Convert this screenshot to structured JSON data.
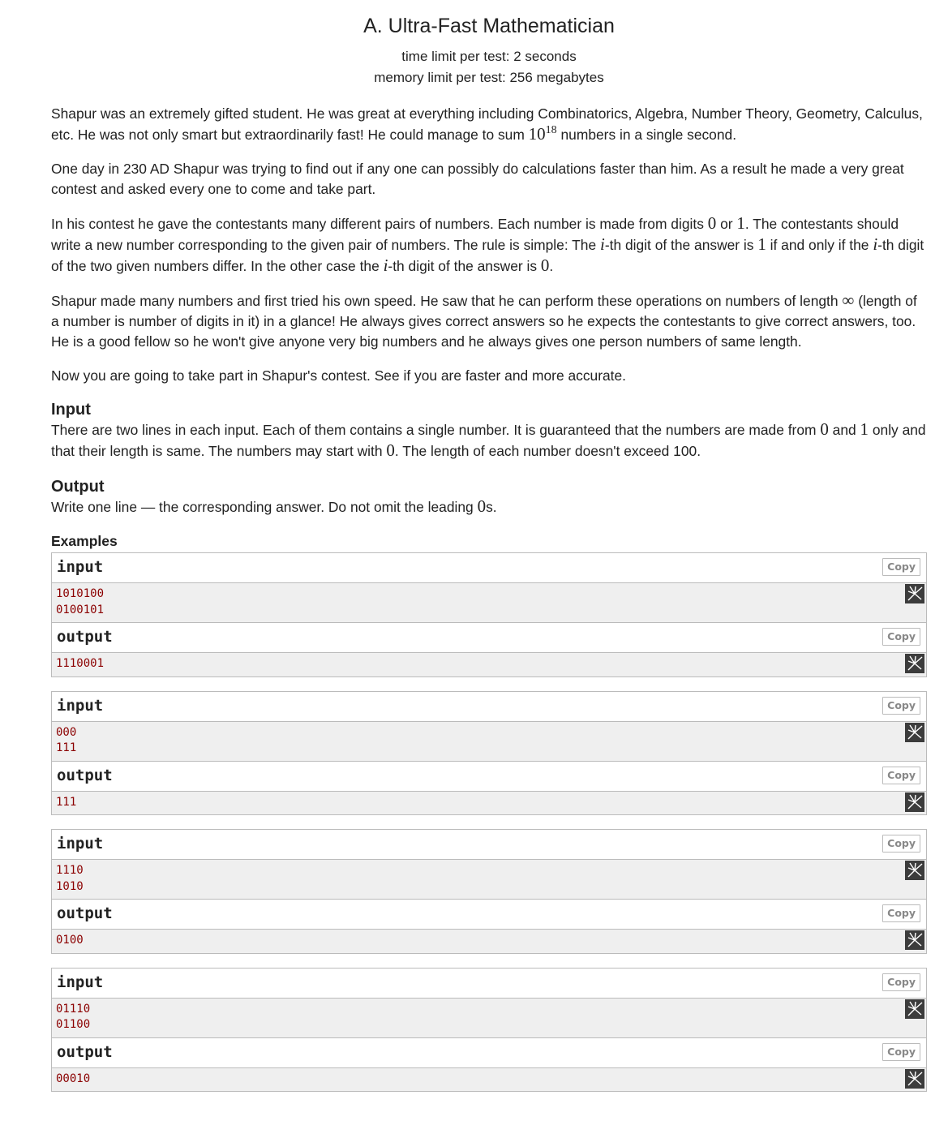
{
  "problem": {
    "title": "A. Ultra-Fast Mathematician",
    "time_limit": "time limit per test: 2 seconds",
    "memory_limit": "memory limit per test: 256 megabytes"
  },
  "statement": {
    "p1a": "Shapur was an extremely gifted student. He was great at everything including Combinatorics, Algebra, Number Theory, Geometry, Calculus, etc. He was not only smart but extraordinarily fast! He could manage to sum ",
    "p1_base": "10",
    "p1_exp": "18",
    "p1b": " numbers in a single second.",
    "p2": "One day in 230 AD Shapur was trying to find out if any one can possibly do calculations faster than him. As a result he made a very great contest and asked every one to come and take part.",
    "p3a": "In his contest he gave the contestants many different pairs of numbers. Each number is made from digits ",
    "p3_zero": "0",
    "p3b": " or ",
    "p3_one": "1",
    "p3c": ". The contestants should write a new number corresponding to the given pair of numbers. The rule is simple: The ",
    "p3_i1": "i",
    "p3d": "-th digit of the answer is ",
    "p3_one2": "1",
    "p3e": " if and only if the ",
    "p3_i2": "i",
    "p3f": "-th digit of the two given numbers differ. In the other case the ",
    "p3_i3": "i",
    "p3g": "-th digit of the answer is ",
    "p3_zero2": "0",
    "p3h": ".",
    "p4a": "Shapur made many numbers and first tried his own speed. He saw that he can perform these operations on numbers of length ",
    "p4_inf": "∞",
    "p4b": " (length of a number is number of digits in it) in a glance! He always gives correct answers so he expects the contestants to give correct answers, too. He is a good fellow so he won't give anyone very big numbers and he always gives one person numbers of same length.",
    "p5": "Now you are going to take part in Shapur's contest. See if you are faster and more accurate."
  },
  "input_section": {
    "title": "Input",
    "a": "There are two lines in each input. Each of them contains a single number. It is guaranteed that the numbers are made from ",
    "zero": "0",
    "b": " and ",
    "one": "1",
    "c": " only and that their length is same. The numbers may start with ",
    "zero2": "0",
    "d": ". The length of each number doesn't exceed 100."
  },
  "output_section": {
    "title": "Output",
    "a": "Write one line — the corresponding answer. Do not omit the leading ",
    "zero": "0",
    "b": "s."
  },
  "examples": {
    "title": "Examples",
    "input_label": "input",
    "output_label": "output",
    "copy_label": "Copy",
    "items": [
      {
        "input": [
          "1010100",
          "0100101"
        ],
        "output": [
          "1110001"
        ]
      },
      {
        "input": [
          "000",
          "111"
        ],
        "output": [
          "111"
        ]
      },
      {
        "input": [
          "1110",
          "1010"
        ],
        "output": [
          "0100"
        ]
      },
      {
        "input": [
          "01110",
          "01100"
        ],
        "output": [
          "00010"
        ]
      }
    ]
  }
}
